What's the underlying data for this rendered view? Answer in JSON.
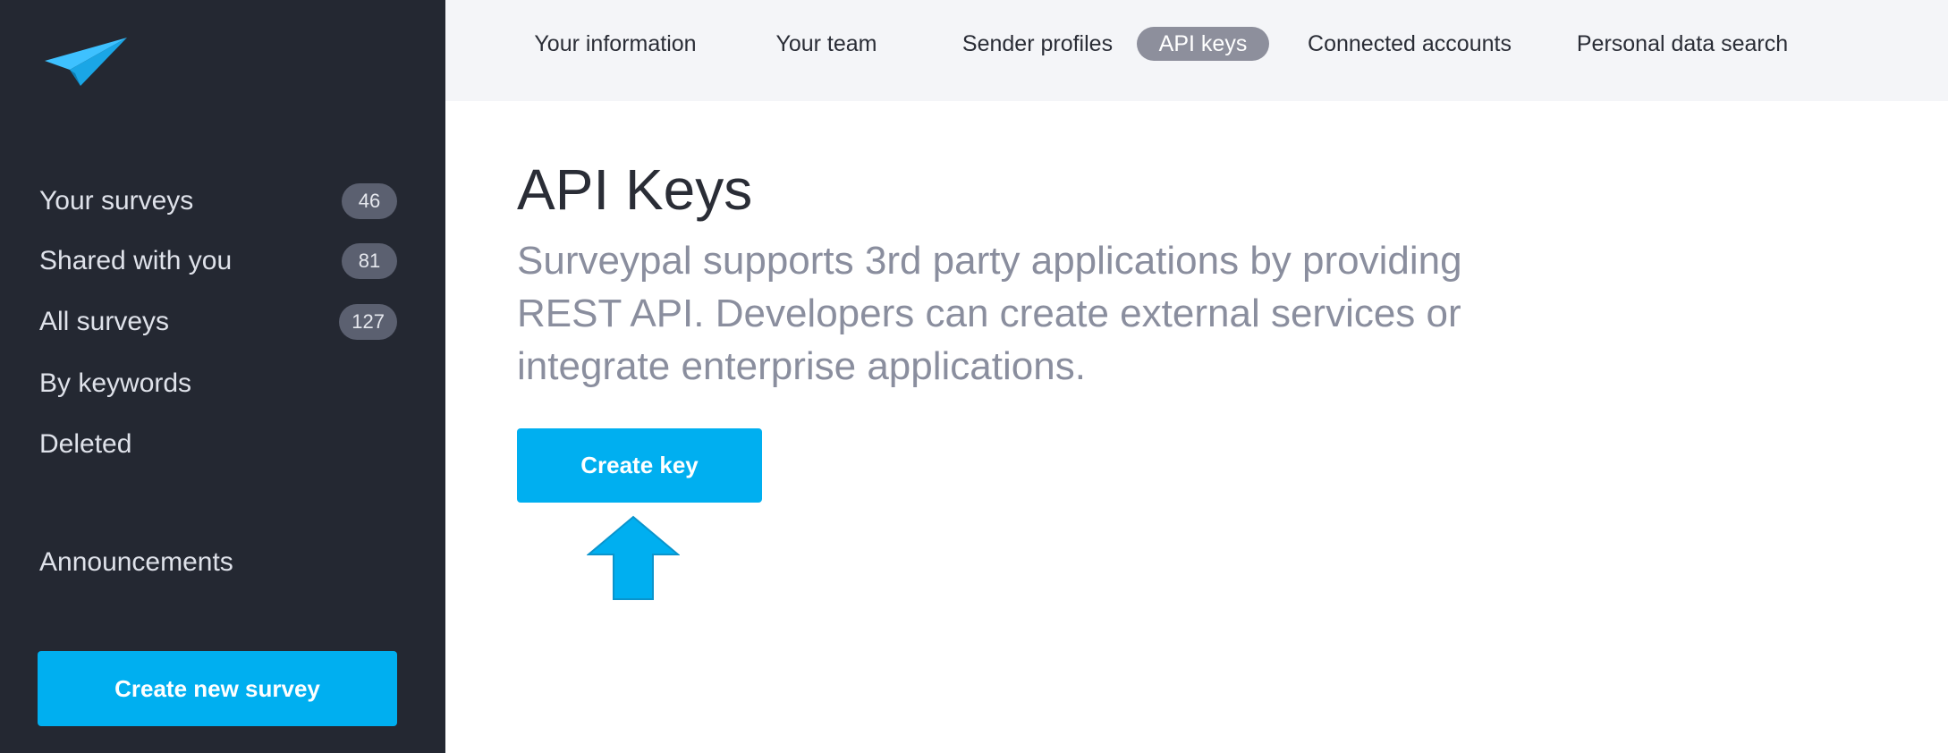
{
  "sidebar": {
    "logo_icon": "paper-plane-icon",
    "items": [
      {
        "label": "Your surveys",
        "count": "46"
      },
      {
        "label": "Shared with you",
        "count": "81"
      },
      {
        "label": "All surveys",
        "count": "127"
      },
      {
        "label": "By keywords"
      },
      {
        "label": "Deleted"
      },
      {
        "label": "Announcements"
      }
    ],
    "create_button_label": "Create new survey"
  },
  "tabs": [
    {
      "label": "Your information"
    },
    {
      "label": "Your team"
    },
    {
      "label": "Sender profiles"
    },
    {
      "label": "API keys",
      "active": true
    },
    {
      "label": "Connected accounts"
    },
    {
      "label": "Personal data search"
    }
  ],
  "main": {
    "title": "API Keys",
    "description": "Surveypal supports 3rd party applications by providing REST API. Developers can create external services or integrate enterprise applications.",
    "create_key_label": "Create key",
    "annotation_icon": "arrow-up-icon"
  },
  "colors": {
    "sidebar_bg": "#242832",
    "accent": "#00aff0",
    "active_tab": "#8d8f9c"
  }
}
